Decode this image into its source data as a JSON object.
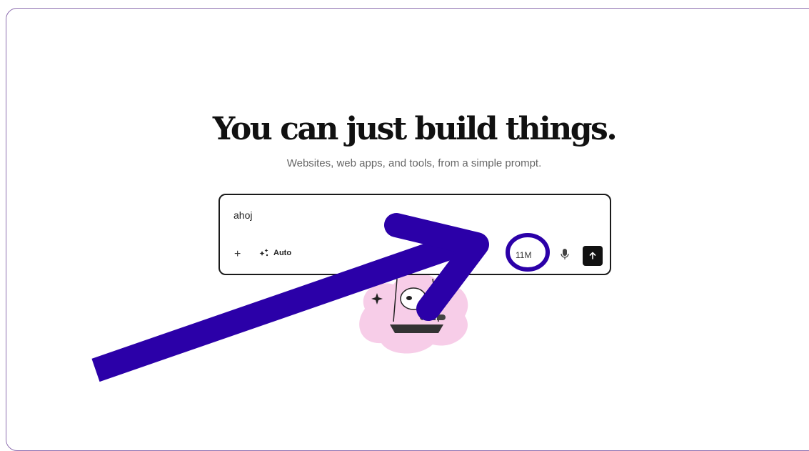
{
  "hero": {
    "headline": "You can just build things.",
    "subtitle": "Websites, web apps, and tools, from a simple prompt."
  },
  "prompt": {
    "text": "ahoj",
    "add_icon": "plus-icon",
    "model_icon": "sparkles-icon",
    "model_label": "Auto",
    "token_count": "11M",
    "mic_icon": "microphone-icon",
    "send_icon": "arrow-up-icon"
  },
  "mascot": {
    "icon": "raccoon-on-swing-illustration"
  },
  "annotation": {
    "color": "#2b00a8",
    "shapes": [
      "arrow",
      "circle"
    ]
  },
  "colors": {
    "frame_border": "#8e6fb0",
    "headline": "#111111",
    "subtitle": "#666666",
    "send_button": "#111111",
    "mascot_blob": "#f7cde8"
  }
}
